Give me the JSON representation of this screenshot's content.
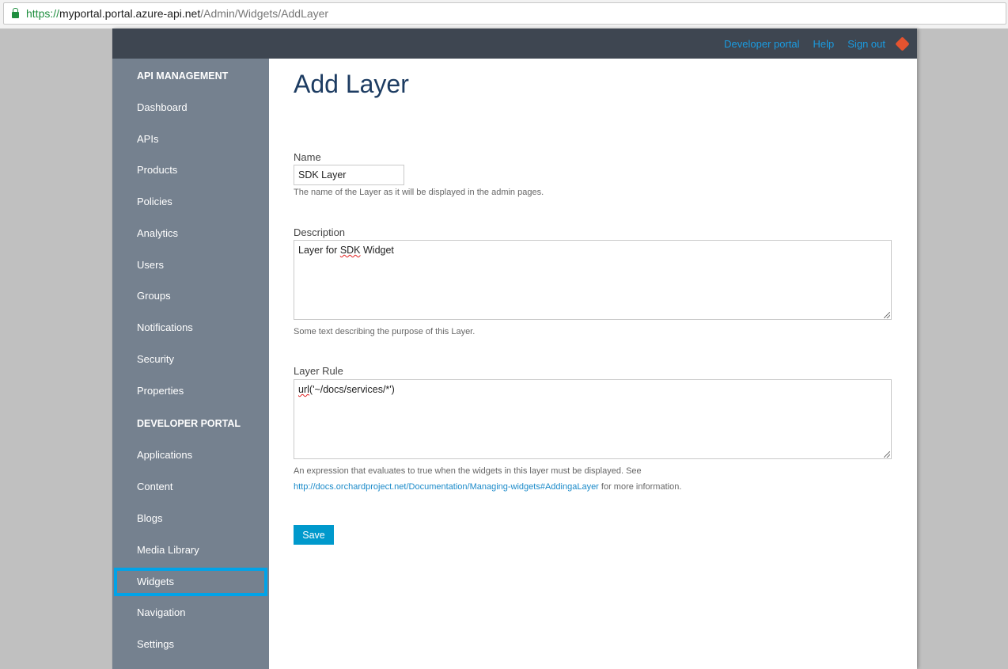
{
  "browser": {
    "url_scheme": "https://",
    "url_host": "myportal.portal.azure-api.net",
    "url_path": "/Admin/Widgets/AddLayer"
  },
  "topbar": {
    "links": [
      "Developer portal",
      "Help",
      "Sign out"
    ],
    "icon": "git-icon"
  },
  "sidebar": {
    "section1": "API MANAGEMENT",
    "items1": [
      "Dashboard",
      "APIs",
      "Products",
      "Policies",
      "Analytics",
      "Users",
      "Groups",
      "Notifications",
      "Security",
      "Properties"
    ],
    "section2": "DEVELOPER PORTAL",
    "items2": [
      "Applications",
      "Content",
      "Blogs",
      "Media Library",
      "Widgets",
      "Navigation",
      "Settings"
    ],
    "active": "Widgets",
    "highlight_color": "#00a3e8"
  },
  "form": {
    "title": "Add Layer",
    "name": {
      "label": "Name",
      "value": "SDK Layer",
      "hint": "The name of the Layer as it will be displayed in the admin pages."
    },
    "description": {
      "label": "Description",
      "value_pre": "Layer for ",
      "value_spell": "SDK",
      "value_post": " Widget",
      "hint": "Some text describing the purpose of this Layer."
    },
    "rule": {
      "label": "Layer Rule",
      "value_spell": "url",
      "value_post": "('~/docs/services/*')",
      "hint_line1": "An expression that evaluates to true when the widgets in this layer must be displayed. See",
      "hint_link": "http://docs.orchardproject.net/Documentation/Managing-widgets#AddingaLayer",
      "hint_line2_post": " for more information."
    },
    "save_label": "Save"
  }
}
